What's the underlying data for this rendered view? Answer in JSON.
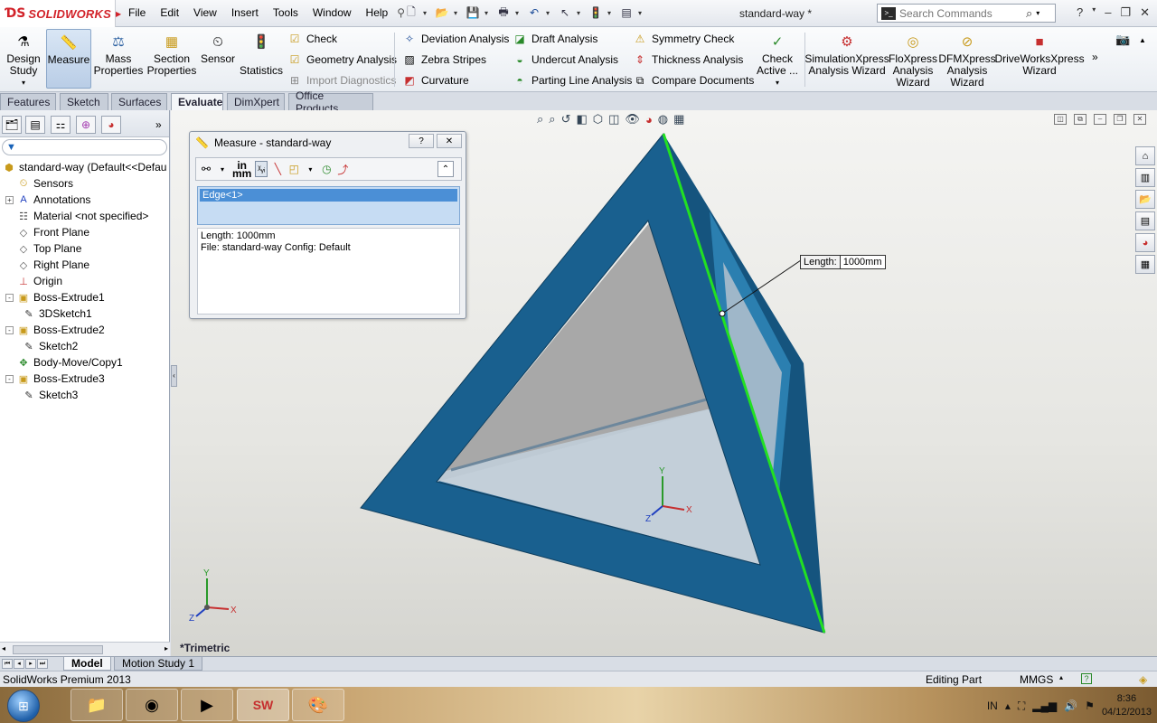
{
  "app": {
    "brand": "SOLIDWORKS",
    "doc_title": "standard-way *",
    "menu": [
      "File",
      "Edit",
      "View",
      "Insert",
      "Tools",
      "Window",
      "Help"
    ],
    "search_placeholder": "Search Commands"
  },
  "cmd": {
    "design_study": "Design Study",
    "measure": "Measure",
    "mass_properties": "Mass Properties",
    "section_properties": "Section Properties",
    "sensor": "Sensor",
    "statistics": "Statistics",
    "check": "Check",
    "geometry_analysis": "Geometry Analysis",
    "import_diagnostics": "Import Diagnostics",
    "deviation_analysis": "Deviation Analysis",
    "zebra_stripes": "Zebra Stripes",
    "curvature": "Curvature",
    "draft_analysis": "Draft Analysis",
    "undercut_analysis": "Undercut Analysis",
    "parting_line_analysis": "Parting Line Analysis",
    "symmetry_check": "Symmetry Check",
    "thickness_analysis": "Thickness Analysis",
    "compare_documents": "Compare Documents",
    "check_active": "Check Active ...",
    "simulationxpress": "SimulationXpress Analysis Wizard",
    "floxpress": "FloXpress Analysis Wizard",
    "dfmxpress": "DFMXpress Analysis Wizard",
    "driveworksxpress": "DriveWorksXpress Wizard"
  },
  "tabs": [
    "Features",
    "Sketch",
    "Surfaces",
    "Evaluate",
    "DimXpert",
    "Office Products"
  ],
  "active_tab": "Evaluate",
  "tree": [
    {
      "label": "standard-way  (Default<<Defau",
      "icon": "part-icon",
      "level": 0
    },
    {
      "label": "Sensors",
      "icon": "sensor-icon",
      "level": 1
    },
    {
      "label": "Annotations",
      "icon": "annotation-icon",
      "level": 1,
      "expand": "+"
    },
    {
      "label": "Material <not specified>",
      "icon": "material-icon",
      "level": 1
    },
    {
      "label": "Front Plane",
      "icon": "plane-icon",
      "level": 1
    },
    {
      "label": "Top Plane",
      "icon": "plane-icon",
      "level": 1
    },
    {
      "label": "Right Plane",
      "icon": "plane-icon",
      "level": 1
    },
    {
      "label": "Origin",
      "icon": "origin-icon",
      "level": 1
    },
    {
      "label": "Boss-Extrude1",
      "icon": "extrude-icon",
      "level": 1,
      "expand": "-"
    },
    {
      "label": "3DSketch1",
      "icon": "3dsketch-icon",
      "level": 2
    },
    {
      "label": "Boss-Extrude2",
      "icon": "extrude-icon",
      "level": 1,
      "expand": "-"
    },
    {
      "label": "Sketch2",
      "icon": "sketch-icon",
      "level": 2
    },
    {
      "label": "Body-Move/Copy1",
      "icon": "move-copy-icon",
      "level": 1
    },
    {
      "label": "Boss-Extrude3",
      "icon": "extrude-icon",
      "level": 1,
      "expand": "-"
    },
    {
      "label": "Sketch3",
      "icon": "sketch-icon",
      "level": 2
    }
  ],
  "measure": {
    "title": "Measure - standard-way",
    "selection": "Edge<1>",
    "result_line1": "Length: 1000mm",
    "result_line2": "File: standard-way Config: Default",
    "units_label_top": "in",
    "units_label_bottom": "mm"
  },
  "callout": {
    "key": "Length:",
    "value": "1000mm"
  },
  "view_label": "*Trimetric",
  "bottom_tabs": [
    "Model",
    "Motion Study 1"
  ],
  "status": {
    "product": "SolidWorks Premium 2013",
    "mode": "Editing Part",
    "units": "MMGS"
  },
  "taskbar": {
    "lang": "IN",
    "time": "8:36",
    "date": "04/12/2013"
  },
  "colors": {
    "part_blue": "#1a5f8c",
    "edge_green": "#22e022",
    "brand_red": "#d2232a"
  }
}
